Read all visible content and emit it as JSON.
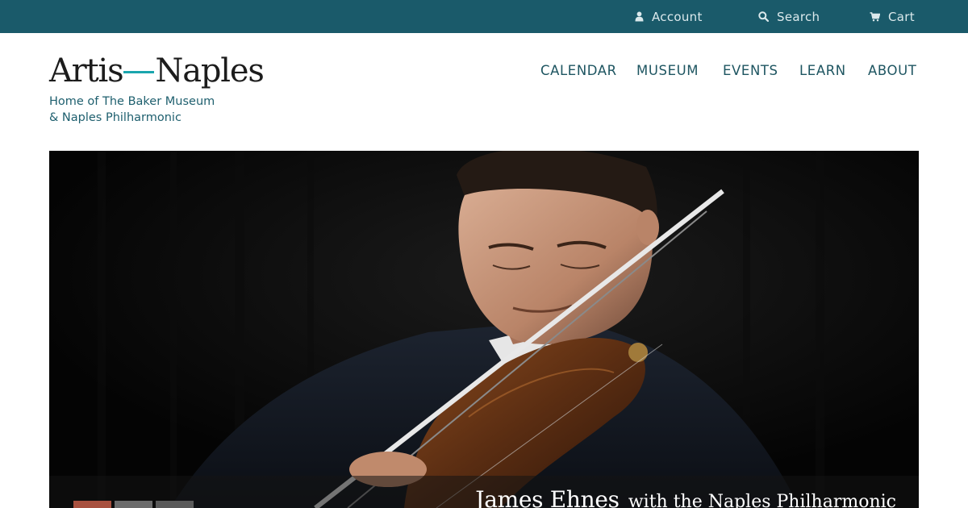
{
  "utility_nav": {
    "account": {
      "label": "Account",
      "icon": "user-icon"
    },
    "search": {
      "label": "Search",
      "icon": "search-icon"
    },
    "cart": {
      "label": "Cart",
      "icon": "cart-icon"
    }
  },
  "brand": {
    "logo_left": "Artis",
    "logo_right": "Naples",
    "tagline_line1": "Home of The Baker Museum",
    "tagline_line2": "& Naples Philharmonic",
    "accent_color": "#1aa5ad"
  },
  "main_nav": {
    "items": [
      {
        "label": "CALENDAR"
      },
      {
        "label": "MUSEUM"
      },
      {
        "label": "EVENTS"
      },
      {
        "label": "LEARN"
      },
      {
        "label": "ABOUT"
      }
    ]
  },
  "hero": {
    "image": "violinist-performing",
    "title": "James Ehnes",
    "subtitle": "with the Naples Philharmonic",
    "slides": 3,
    "active_slide": 1
  },
  "colors": {
    "topbar": "#1a5a6a",
    "nav_text": "#1e5561",
    "active_dot": "#a8513f"
  }
}
